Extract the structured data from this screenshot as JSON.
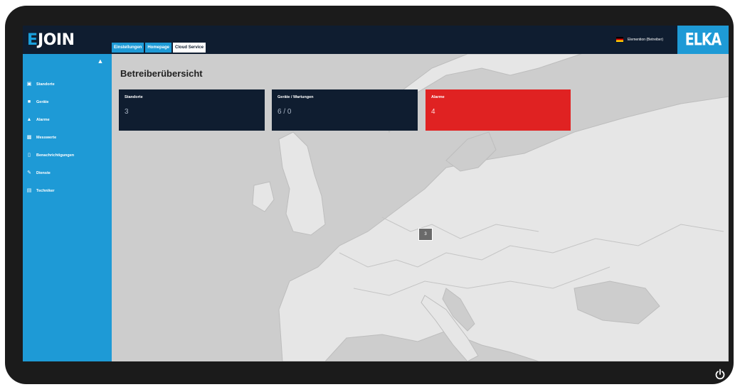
{
  "header": {
    "logo_prefix": "E",
    "logo_rest": "JOIN",
    "tabs": [
      {
        "label": "Einstellungen",
        "active": false
      },
      {
        "label": "Homepage",
        "active": false
      },
      {
        "label": "Cloud Service",
        "active": true
      }
    ],
    "user_name": "Elemention (Betreiber)",
    "brand": "ELKA"
  },
  "sidebar": {
    "toggle_icon": "bell-icon",
    "items": [
      {
        "label": "Standorte",
        "icon": "map-icon"
      },
      {
        "label": "Geräte",
        "icon": "device-icon"
      },
      {
        "label": "Alarme",
        "icon": "warning-icon"
      },
      {
        "label": "Messwerte",
        "icon": "chart-icon"
      },
      {
        "label": "Benachrichtigungen",
        "icon": "phone-icon"
      },
      {
        "label": "Dienste",
        "icon": "wrench-icon"
      },
      {
        "label": "Techniker",
        "icon": "id-card-icon"
      }
    ]
  },
  "main": {
    "title": "Betreiberübersicht",
    "cards": [
      {
        "title": "Standorte",
        "value": "3"
      },
      {
        "title": "Geräte / Wartungen",
        "value": "6 / 0"
      },
      {
        "title": "Alarme",
        "value": "4"
      }
    ],
    "marker_count": "3"
  },
  "colors": {
    "accent": "#1e9ad6",
    "navy": "#0f1d30",
    "alarm": "#e02222",
    "bezel": "#1b1b1b"
  }
}
